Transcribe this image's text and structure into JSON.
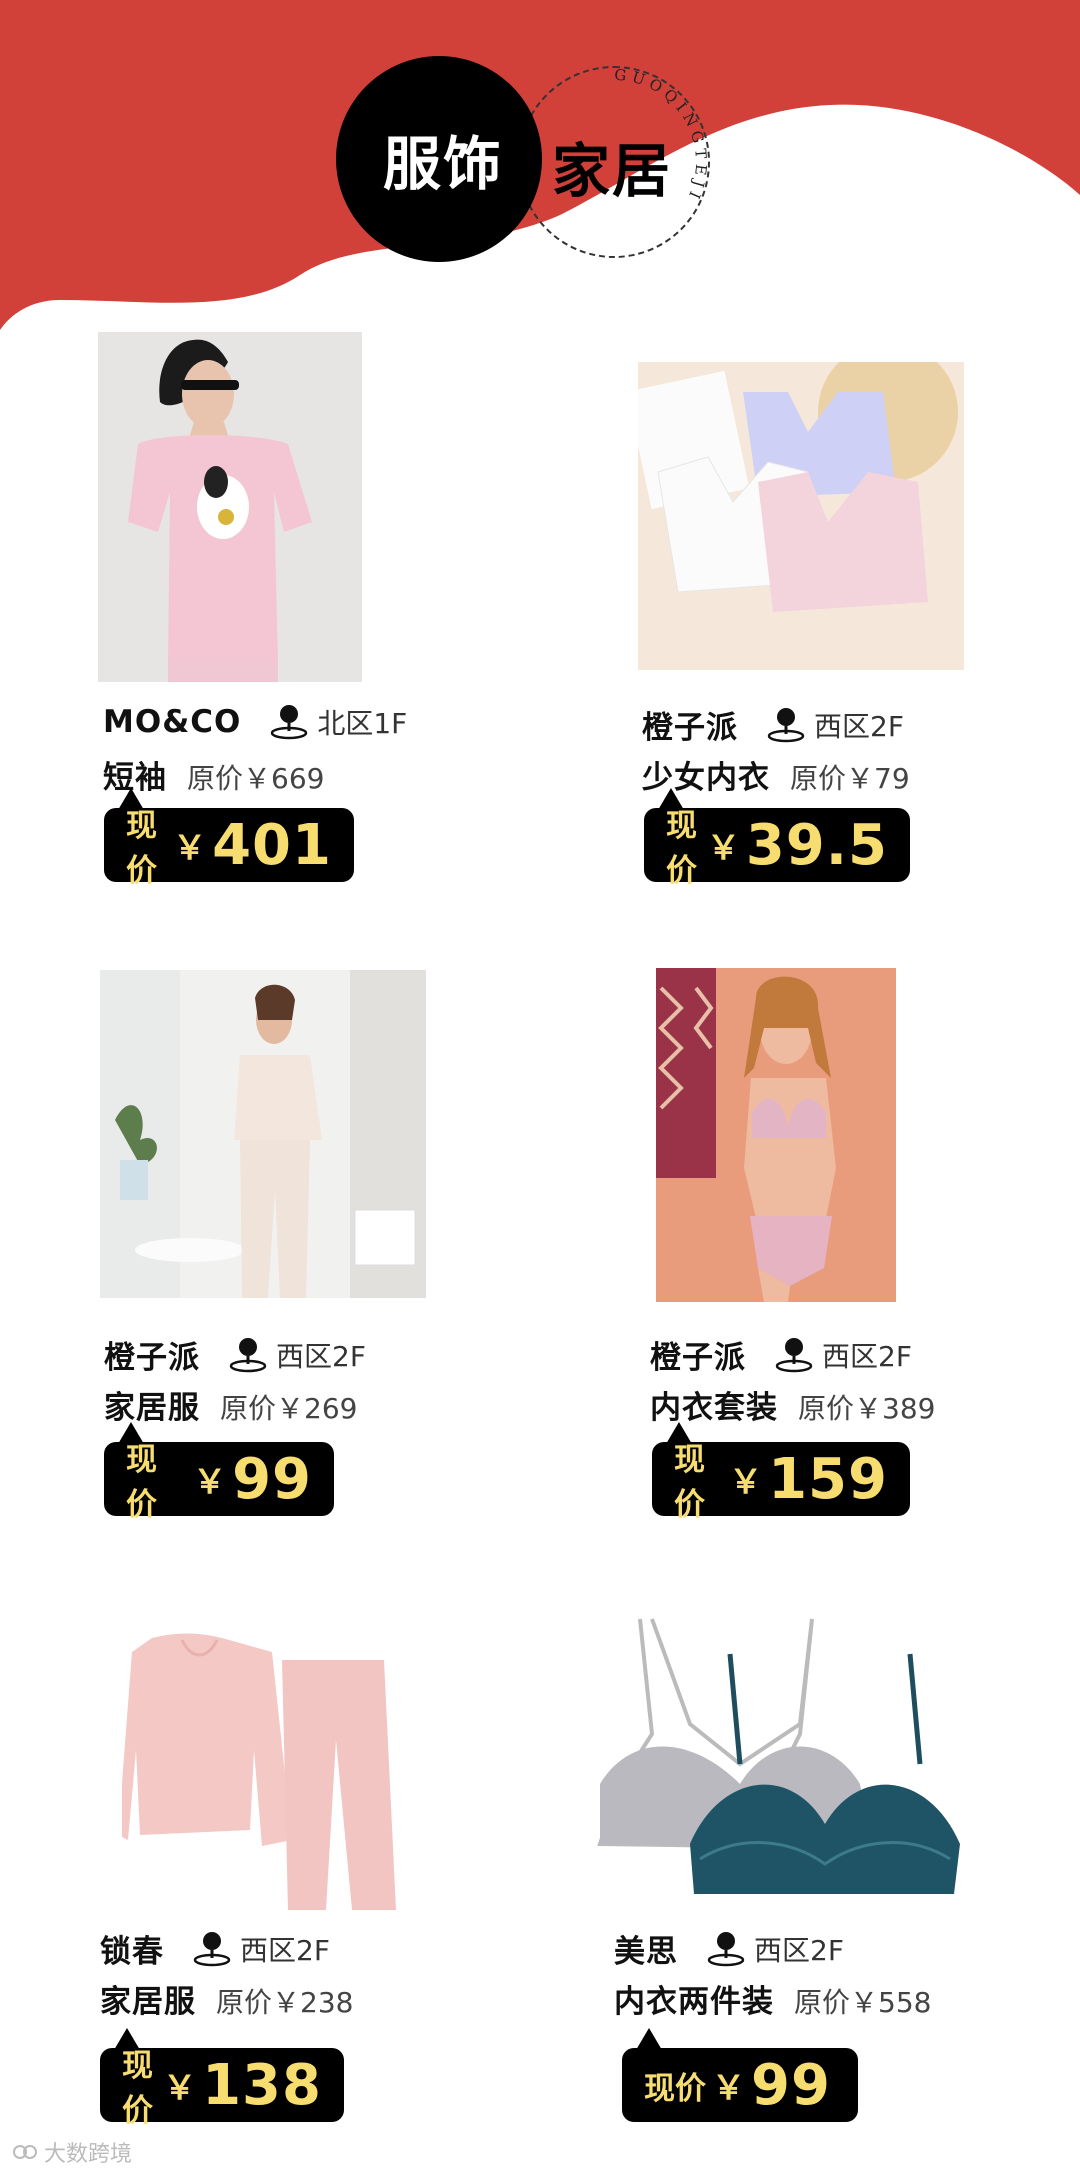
{
  "header": {
    "title_left": "服饰",
    "title_right": "家居",
    "arc_text": "GUOQINGTEJI"
  },
  "colors": {
    "accent_red": "#D2403A",
    "badge_black": "#000000",
    "price_yellow": "#F7DC6F"
  },
  "icons": {
    "location": "location-pin-icon"
  },
  "products": [
    {
      "brand": "MO&CO",
      "location": "北区1F",
      "product": "短袖",
      "original_label": "原价",
      "original_price": "￥669",
      "now_label": "现价",
      "currency": "￥",
      "now_price": "401",
      "image": "pink-tshirt-model"
    },
    {
      "brand": "橙子派",
      "location": "西区2F",
      "product": "少女内衣",
      "original_label": "原价",
      "original_price": "￥79",
      "now_label": "现价",
      "currency": "￥",
      "now_price": "39.5",
      "image": "three-bras"
    },
    {
      "brand": "橙子派",
      "location": "西区2F",
      "product": "家居服",
      "original_label": "原价",
      "original_price": "￥269",
      "now_label": "现价",
      "currency": "￥",
      "now_price": "99",
      "image": "loungewear-model"
    },
    {
      "brand": "橙子派",
      "location": "西区2F",
      "product": "内衣套装",
      "original_label": "原价",
      "original_price": "￥389",
      "now_label": "现价",
      "currency": "￥",
      "now_price": "159",
      "image": "lingerie-model"
    },
    {
      "brand": "锁春",
      "location": "西区2F",
      "product": "家居服",
      "original_label": "原价",
      "original_price": "￥238",
      "now_label": "现价",
      "currency": "￥",
      "now_price": "138",
      "image": "pink-pajama-set"
    },
    {
      "brand": "美思",
      "location": "西区2F",
      "product": "内衣两件装",
      "original_label": "原价",
      "original_price": "￥558",
      "now_label": "现价",
      "currency": "￥",
      "now_price": "99",
      "image": "lace-bras-pair"
    }
  ],
  "watermark": "大数跨境"
}
